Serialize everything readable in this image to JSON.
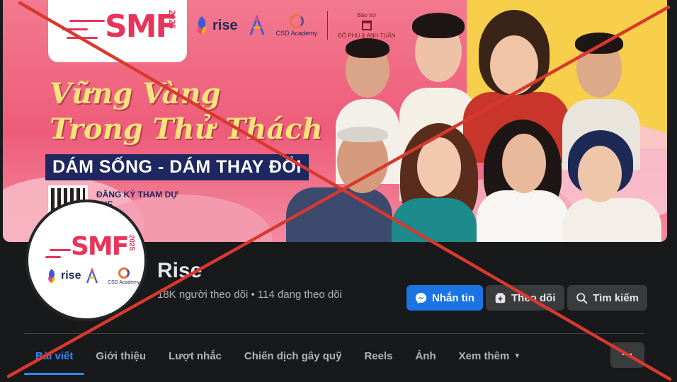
{
  "cover": {
    "logo_text": "SMF",
    "logo_year": "2025",
    "sponsor_brand": "rise",
    "academy": "CSD Academy",
    "patron_label": "Bảo trợ",
    "patron_name": "ĐỖ PHÚ & ANH TUẤN",
    "headline_line1": "Vững Vàng",
    "headline_line2": "Trong Thử Thách",
    "banner": "DÁM SỐNG - DÁM THAY ĐỔI",
    "register_line1": "ĐĂNG KÝ THAM DỰ",
    "register_line2": "..HE"
  },
  "profile": {
    "avatar_logo_text": "SMF",
    "avatar_year": "2025",
    "avatar_brand": "rise",
    "avatar_academy": "CSD Academy",
    "name": "Rise",
    "stats": "18K người theo dõi • 114 đang theo dõi"
  },
  "actions": {
    "message": "Nhắn tin",
    "follow": "Theo dõi",
    "search": "Tìm kiếm"
  },
  "tabs": [
    {
      "label": "Bài viết",
      "active": true
    },
    {
      "label": "Giới thiệu"
    },
    {
      "label": "Lượt nhắc"
    },
    {
      "label": "Chiến dịch gây quỹ"
    },
    {
      "label": "Reels"
    },
    {
      "label": "Ảnh"
    },
    {
      "label": "Xem thêm"
    }
  ],
  "more_button": "···",
  "colors": {
    "background": "#18191a",
    "primary_button": "#1b74e4",
    "active_tab": "#2d88ff",
    "cross_mark": "#d9382e",
    "cover_pink": "#ee5c7a",
    "cover_yellow": "#f7cf4a"
  }
}
